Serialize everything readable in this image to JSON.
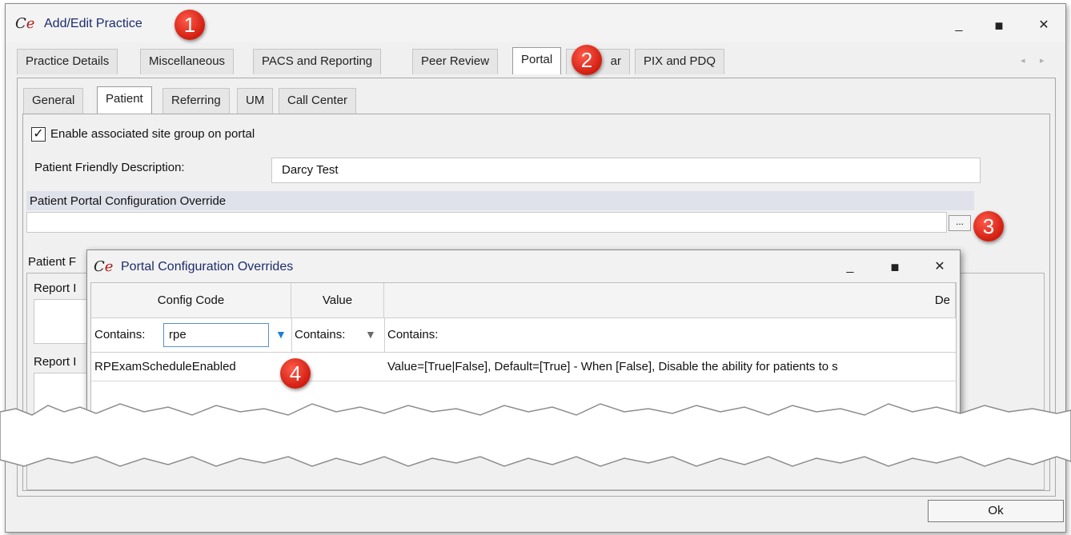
{
  "main_window": {
    "title": "Add/Edit Practice",
    "controls": {
      "minimize": "_",
      "maximize": "▭",
      "close": "✕"
    },
    "tabs": [
      "Practice Details",
      "Miscellaneous",
      "PACS and Reporting",
      "Peer Review",
      "Portal",
      "ar",
      "PIX and PDQ"
    ],
    "active_tab": "Portal",
    "tab_scroll": {
      "left": "◂",
      "right": "▸"
    },
    "subtabs": [
      "General",
      "Patient",
      "Referring",
      "UM",
      "Call Center"
    ],
    "active_subtab": "Patient"
  },
  "patient_tab": {
    "enable_checkbox_label": "Enable associated site group on portal",
    "enable_checked": true,
    "check_mark": "✓",
    "friendly_description_label": "Patient Friendly Description:",
    "friendly_description_value": "Darcy Test",
    "config_override_label": "Patient Portal Configuration Override",
    "config_override_value": "",
    "ellipsis_label": "...",
    "truncated_group_label": "Patient F",
    "report_label_1": "Report I",
    "report_label_2": "Report I"
  },
  "overrides_window": {
    "title": "Portal Configuration Overrides",
    "controls": {
      "minimize": "_",
      "maximize": "▭",
      "close": "✕"
    },
    "columns": [
      "Config Code",
      "Value",
      "De"
    ],
    "filter_label": "Contains:",
    "filter_config_code": "rpe",
    "rows": [
      {
        "config_code": "RPExamScheduleEnabled",
        "value": "",
        "description": "Value=[True|False], Default=[True] - When [False], Disable the ability for patients to s"
      }
    ]
  },
  "footer": {
    "ok_label": "Ok"
  },
  "annotations": [
    "1",
    "2",
    "3",
    "4"
  ],
  "colors": {
    "badge": "#d01d10",
    "title_text": "#1c2d6b",
    "filter_active": "#1a7fd6"
  }
}
